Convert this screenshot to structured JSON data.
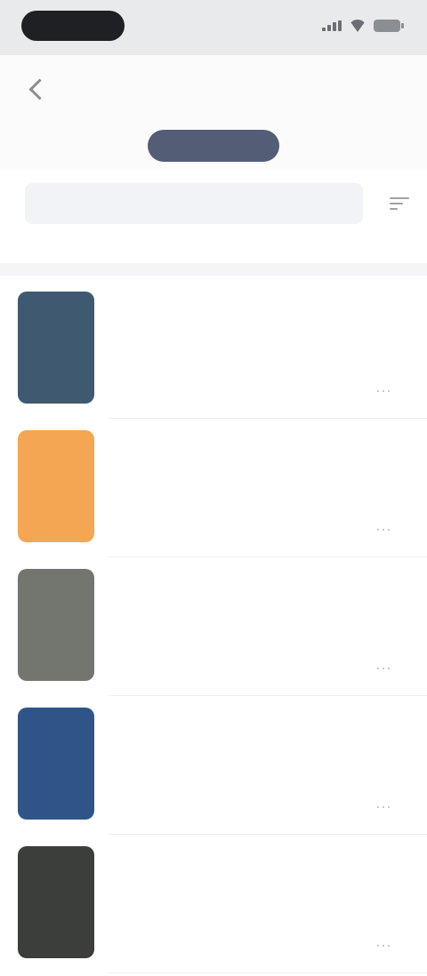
{
  "status_bar": {
    "time": "",
    "icons": [
      "signal-icon",
      "wifi-icon",
      "battery-icon"
    ]
  },
  "nav": {
    "title": "",
    "back_icon": "chevron-left-icon"
  },
  "tabs": [
    {
      "label": "",
      "active": false
    },
    {
      "label": "",
      "active": true
    },
    {
      "label": "",
      "active": false
    }
  ],
  "filter": {
    "label": "",
    "icon": "filter-icon",
    "count_text": ""
  },
  "list": {
    "items": [
      {
        "title": "",
        "subtitle": "",
        "thumb_color": "#3f5a70",
        "more_icon": "more-icon"
      },
      {
        "title": "",
        "subtitle": "",
        "thumb_color": "#f4a653",
        "more_icon": "more-icon"
      },
      {
        "title": "",
        "subtitle": "",
        "thumb_color": "#73766f",
        "more_icon": "more-icon"
      },
      {
        "title": "",
        "subtitle": "",
        "thumb_color": "#2f5588",
        "more_icon": "more-icon"
      },
      {
        "title": "",
        "subtitle": "",
        "thumb_color": "#3c3e3c",
        "more_icon": "more-icon"
      }
    ]
  },
  "colors": {
    "accent": "#535d76",
    "background": "#ffffff",
    "status_bar": "#e9eaec"
  }
}
